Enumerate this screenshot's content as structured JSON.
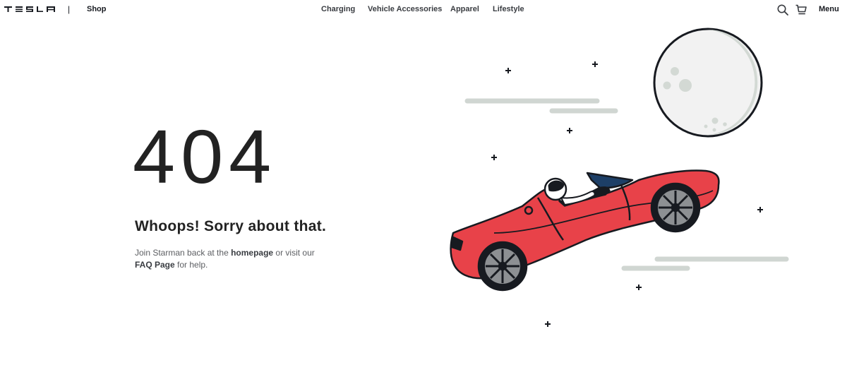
{
  "header": {
    "logo_text": "TESLA",
    "divider": "|",
    "shop_label": "Shop",
    "nav": [
      "Charging",
      "Vehicle Accessories",
      "Apparel",
      "Lifestyle"
    ],
    "search_icon": "search-icon",
    "cart_icon": "cart-icon",
    "menu_label": "Menu"
  },
  "error": {
    "code": "404",
    "headline": "Whoops! Sorry about that.",
    "text_before": "Join Starman back at the ",
    "homepage_link": "homepage",
    "text_middle": " or visit our ",
    "faq_link": "FAQ Page",
    "text_after": " for help."
  },
  "illustration": {
    "subject": "starman-roadster-illustration",
    "car_color": "#e84249",
    "moon_color": "#f2f2f2",
    "streak_color": "#d0d6d2"
  }
}
